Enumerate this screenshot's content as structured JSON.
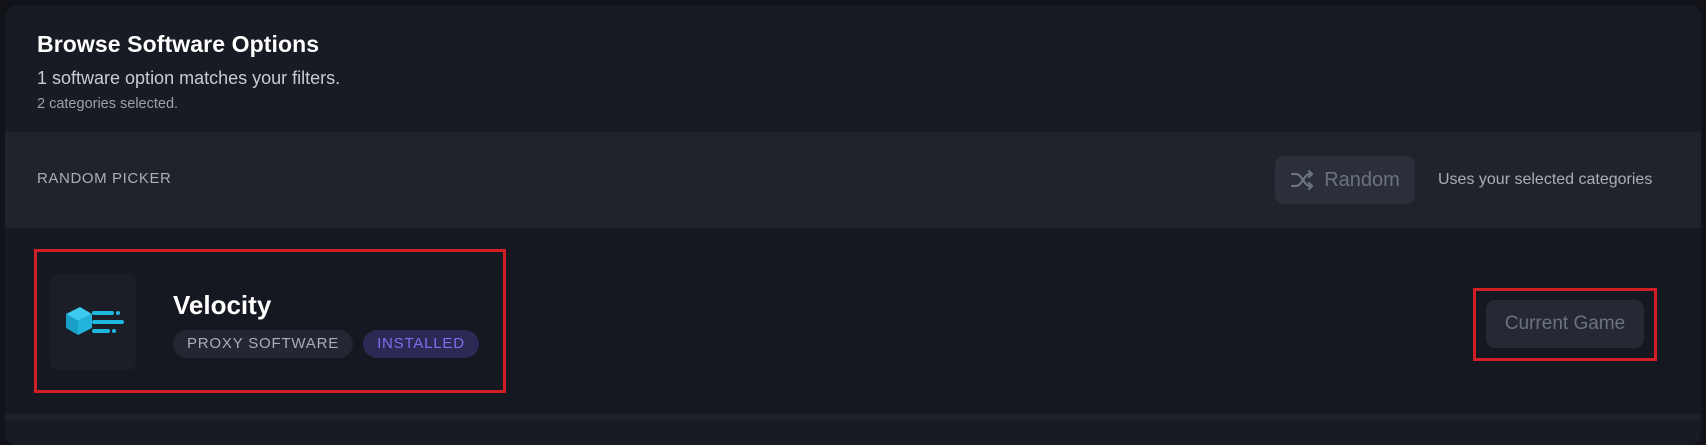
{
  "header": {
    "title": "Browse Software Options",
    "match_text": "1 software option matches your filters.",
    "categories_text": "2 categories selected."
  },
  "random_picker": {
    "label": "RANDOM PICKER",
    "button_label": "Random",
    "button_icon": "shuffle-icon",
    "note": "Uses your selected categories"
  },
  "software": {
    "items": [
      {
        "name": "Velocity",
        "icon": "velocity-logo",
        "category_tag": "PROXY SOFTWARE",
        "status_tag": "INSTALLED",
        "action_label": "Current Game"
      }
    ]
  },
  "colors": {
    "background": "#181b23",
    "picker_band": "#1f232c",
    "installed_badge_text": "#7a6ff0",
    "highlight_border": "#d21f26",
    "logo_accent": "#1fb7e0"
  }
}
